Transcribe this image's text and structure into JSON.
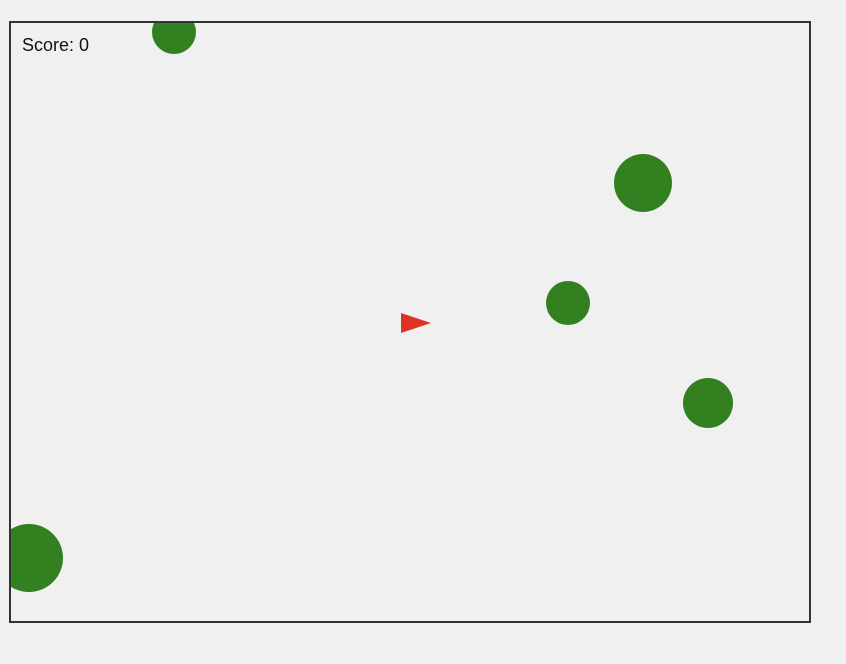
{
  "hud": {
    "score_label": "Score: 0",
    "score_value": 0
  },
  "colors": {
    "background": "#f0f0f0",
    "border": "#333333",
    "asteroid": "#338020",
    "ship": "#e03125"
  },
  "entities": {
    "ship": {
      "kind": "ship",
      "heading": "right"
    },
    "asteroids": [
      {
        "kind": "asteroid",
        "size": "small"
      },
      {
        "kind": "asteroid",
        "size": "large"
      },
      {
        "kind": "asteroid",
        "size": "small"
      },
      {
        "kind": "asteroid",
        "size": "medium"
      },
      {
        "kind": "asteroid",
        "size": "large"
      }
    ]
  }
}
